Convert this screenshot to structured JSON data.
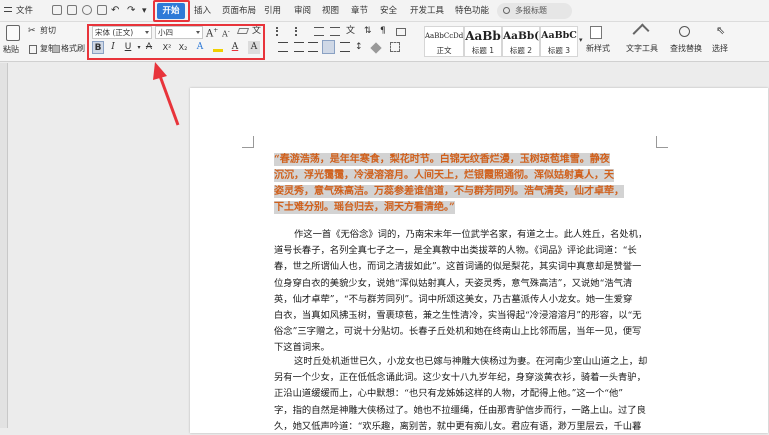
{
  "menubar": {
    "file": "文件",
    "tabs": [
      "开始",
      "插入",
      "页面布局",
      "引用",
      "审阅",
      "视图",
      "章节",
      "安全",
      "开发工具",
      "特色功能"
    ],
    "search": "多报标题",
    "quick_access_icons": [
      "save-icon",
      "print-icon",
      "preview-icon",
      "undo-icon",
      "redo-icon",
      "customize-icon"
    ]
  },
  "ribbon": {
    "paste": "粘贴",
    "cut": "剪切",
    "copy": "复制",
    "format_painter": "格式刷",
    "font_name": "宋体 (正文)",
    "font_size": "小四",
    "format_buttons": [
      "B",
      "I",
      "U",
      "A",
      "X²",
      "X₂",
      "A",
      "A",
      "A"
    ],
    "styles": [
      {
        "sample": "AaBbCcDd",
        "label": "正文"
      },
      {
        "sample": "AaBb",
        "label": "标题 1"
      },
      {
        "sample": "AaBb(",
        "label": "标题 2"
      },
      {
        "sample": "AaBbC",
        "label": "标题 3"
      }
    ],
    "new_style": "新样式",
    "text_tools": "文字工具",
    "find_replace": "查找替换",
    "select": "选择",
    "accent_color": "#2e7ad7",
    "highlight_color": "#e8343b"
  },
  "document": {
    "poem_lines": [
      "“春游浩荡，是年年寒食，梨花时节。白锦无纹香烂漫，玉树琼苞堆雪。静夜",
      "沉沉，浮光霭霭，冷浸溶溶月。人间天上，烂银霞照通彻。浑似姑射真人，天",
      "姿灵秀，意气殊高洁。万蕊参差谁信道，不与群芳同列。浩气清英，仙才卓荦，",
      "下土难分别。瑶台归去，洞天方看清绝。”"
    ],
    "para1_lines": [
      "作这一首《无俗念》词的，乃南宋末年一位武学名家，有道之士。此人姓丘，名处机，",
      "道号长春子，名列全真七子之一，是全真教中出类拔萃的人物。《词品》评论此词道：“长",
      "春，世之所谓仙人也，而词之清拔如此”。这首词诵的似是梨花，其实词中真意却是赞誉一",
      "位身穿白衣的美貌少女，说她“浑似姑射真人，天姿灵秀，意气殊高洁”，又说她“浩气清",
      "英，仙才卓荦”，“不与群芳同列”。词中所颂这美女，乃古墓派传人小龙女。她一生爱穿",
      "白衣，当真如风拂玉树，雪裹琼苞，兼之生性清冷，实当得起“冷浸溶溶月”的形容，以“无",
      "俗念”三字赠之，可说十分贴切。长春子丘处机和她在终南山上比邻而居，当年一见，便写",
      "下这首词来。"
    ],
    "para2_lines": [
      "这时丘处机逝世已久，小龙女也已嫁与神雕大侠杨过为妻。在河南少室山山道之上，却",
      "另有一个少女，正在低低念诵此词。这少女十八九岁年纪，身穿淡黄衣衫，骑着一头青驴，",
      "正沿山道缓缓而上，心中默想：“也只有龙姊姊这样的人物，才配得上他。”这一个“他”",
      "字，指的自然是神雕大侠杨过了。她也不拉缰绳，任由那青驴信步而行，一路上山。过了良",
      "久，她又低声吟道：“欢乐趣，离别苦，就中更有痴儿女。君应有语，渺万里层云，千山暮"
    ]
  }
}
